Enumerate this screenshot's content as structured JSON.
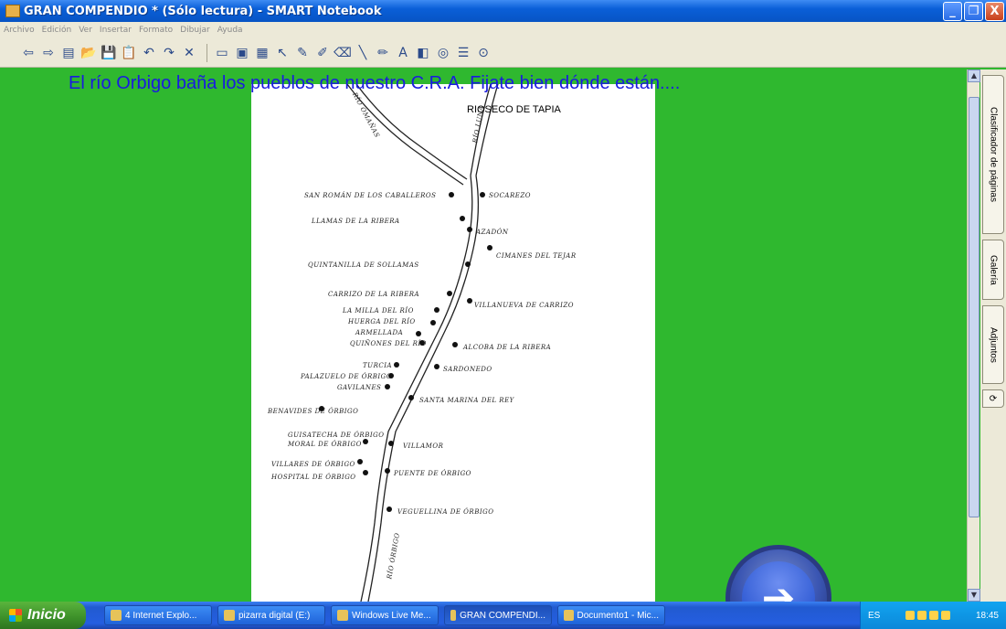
{
  "window": {
    "title": "GRAN COMPENDIO * (Sólo lectura) - SMART Notebook",
    "controls": [
      "_",
      "❐",
      "X"
    ]
  },
  "menu": [
    "Archivo",
    "Edición",
    "Ver",
    "Insertar",
    "Formato",
    "Dibujar",
    "Ayuda"
  ],
  "page": {
    "headline": "El río Orbigo baña los pueblos de nuestro C.R.A. Fijate bien dónde están....",
    "map_title": "RIOSECO DE TAPIA",
    "rivers": [
      "RÍO OMAÑAS",
      "RÍO LUNA",
      "RÍO ÓRBIGO"
    ],
    "towns_left": [
      "SAN ROMÁN DE LOS CABALLEROS",
      "LLAMAS DE LA RIBERA",
      "QUINTANILLA DE SOLLAMAS",
      "CARRIZO DE LA RIBERA",
      "LA MILLA DEL RÍO",
      "HUERGA DEL RÍO",
      "ARMELLADA",
      "QUIÑONES DEL RÍO",
      "TURCIA",
      "PALAZUELO DE ÓRBIGO",
      "GAVILANES",
      "BENAVIDES DE ÓRBIGO",
      "GUISATECHA DE ÓRBIGO",
      "MORAL DE ÓRBIGO",
      "VILLARES DE ÓRBIGO",
      "HOSPITAL DE ÓRBIGO"
    ],
    "towns_right": [
      "SOCAREZO",
      "AZADÓN",
      "CIMANES DEL TEJAR",
      "VILLANUEVA DE CARRIZO",
      "ALCOBA DE LA RIBERA",
      "SARDONEDO",
      "SANTA MARINA DEL REY",
      "VILLAMOR",
      "PUENTE DE ÓRBIGO",
      "VEGUELLINA DE ÓRBIGO"
    ]
  },
  "side_tabs": [
    "Clasificador de páginas",
    "Galería",
    "Adjuntos"
  ],
  "taskbar": {
    "start": "Inicio",
    "items": [
      "4 Internet Explo...",
      "pizarra digital (E:)",
      "Windows Live Me...",
      "GRAN COMPENDI...",
      "Documento1 - Mic..."
    ],
    "lang": "ES",
    "time": "18:45"
  }
}
